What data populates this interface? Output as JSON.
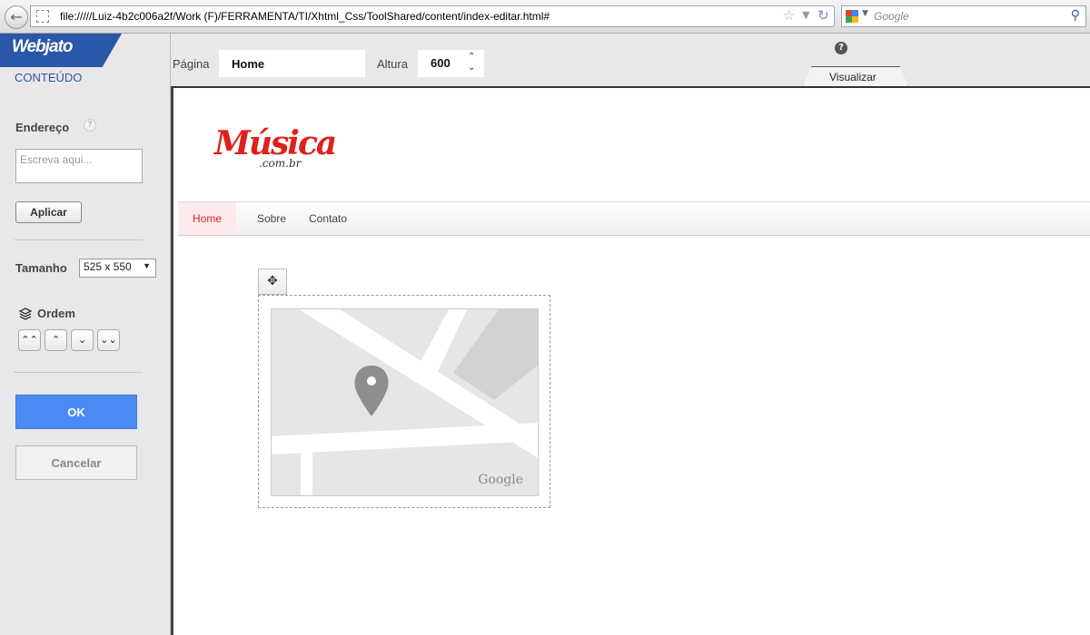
{
  "browser": {
    "url": "file://///Luiz-4b2c006a2f/Work  (F)/FERRAMENTA/TI/Xhtml_Css/ToolShared/content/index-editar.html#",
    "search_placeholder": "Google"
  },
  "sidebar": {
    "logo": "Webjato",
    "section_title": "CONTEÚDO",
    "address_label": "Endereço",
    "address_placeholder": "Escreva aqui...",
    "apply_label": "Aplicar",
    "size_label": "Tamanho",
    "size_value": "525 x 550",
    "order_label": "Ordem",
    "ok_label": "OK",
    "cancel_label": "Cancelar"
  },
  "toolbar": {
    "page_label": "Página",
    "page_value": "Home",
    "height_label": "Altura",
    "height_value": "600",
    "preview_label": "Visualizar"
  },
  "site": {
    "logo_main": "Música",
    "logo_sub": ".com.br",
    "nav": [
      "Home",
      "Sobre",
      "Contato"
    ],
    "map_attribution": "Google"
  }
}
